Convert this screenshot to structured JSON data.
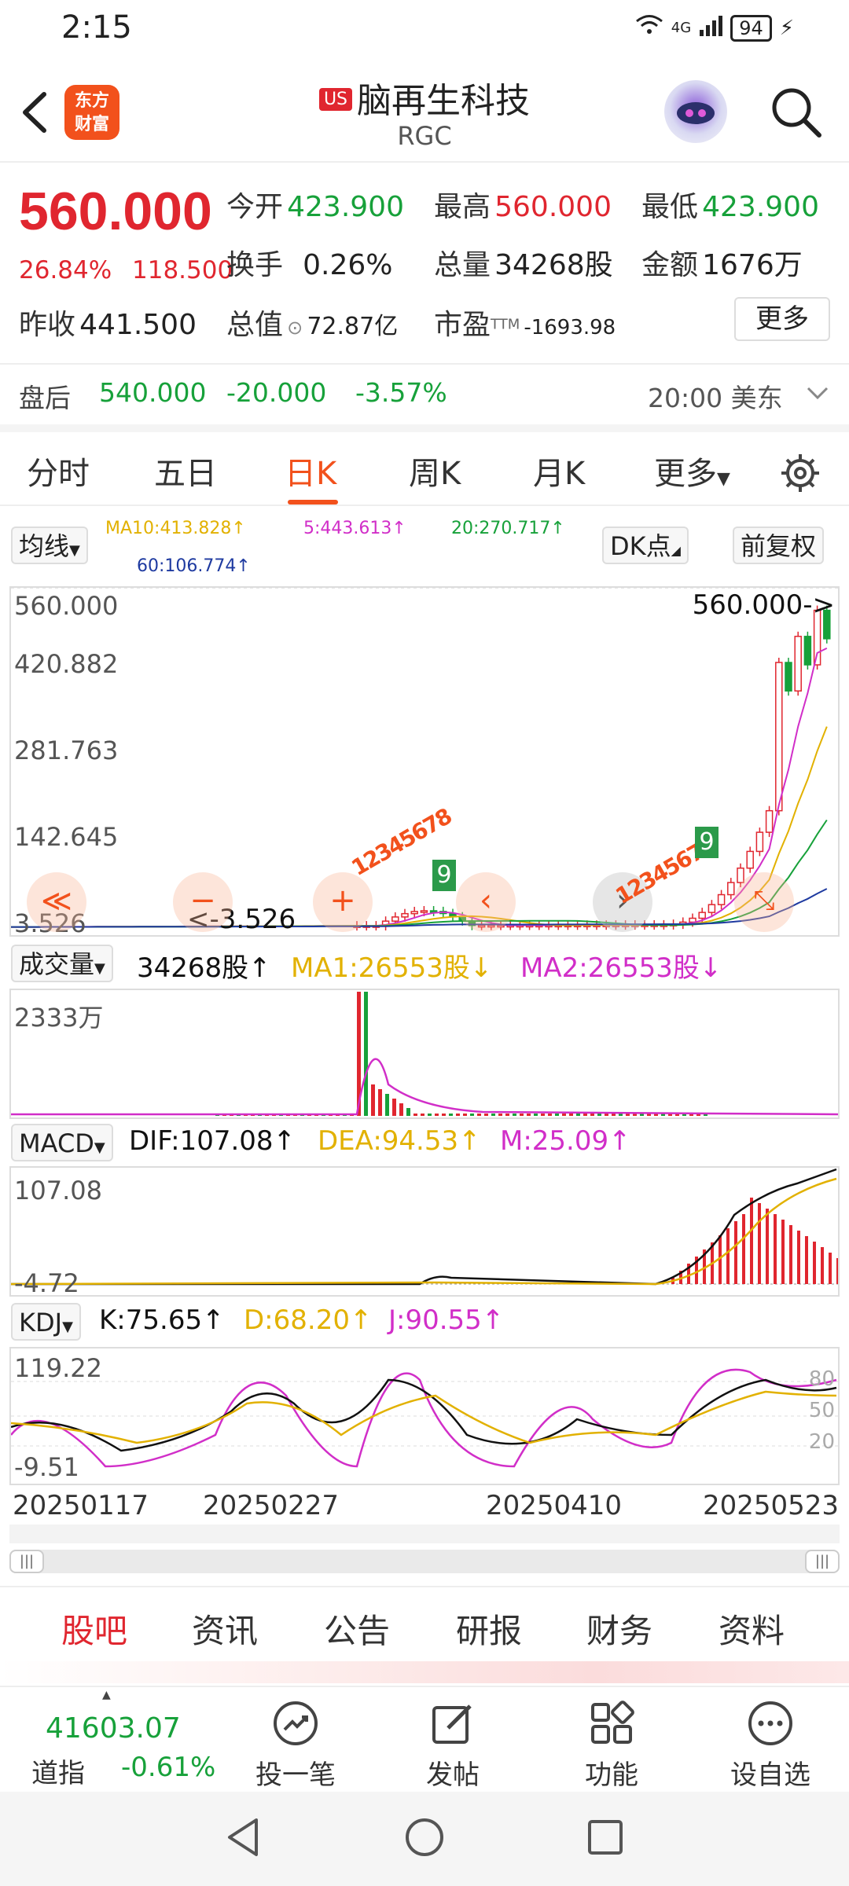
{
  "status": {
    "time": "2:15",
    "battery": "94",
    "net": "4G"
  },
  "header": {
    "logo_line1": "东方",
    "logo_line2": "财富",
    "badge": "US",
    "name": "脑再生科技",
    "code": "RGC"
  },
  "quote": {
    "price": "560.000",
    "change_pct": "26.84%",
    "change_abs": "118.500",
    "open_label": "今开",
    "open": "423.900",
    "high_label": "最高",
    "high": "560.000",
    "low_label": "最低",
    "low": "423.900",
    "turnover_label": "换手",
    "turnover": "0.26%",
    "volume_label": "总量",
    "volume": "34268股",
    "amount_label": "金额",
    "amount": "1676万",
    "prev_close_label": "昨收",
    "prev_close": "441.500",
    "mktcap_label": "总值",
    "mktcap": "72.87亿",
    "pe_label": "市盈",
    "pe_sup": "TTM",
    "pe": "-1693.98",
    "more": "更多"
  },
  "after_hours": {
    "label": "盘后",
    "price": "540.000",
    "change": "-20.000",
    "pct": "-3.57%",
    "time": "20:00 美东"
  },
  "tabs": [
    "分时",
    "五日",
    "日K",
    "周K",
    "月K",
    "更多"
  ],
  "active_tab": "日K",
  "kline": {
    "ma_selector": "均线",
    "ma10": "MA10:413.828↑",
    "ma5": "5:443.613↑",
    "ma20": "20:270.717↑",
    "ma60": "60:106.774↑",
    "dk_btn": "DK点",
    "adjust_btn": "前复权",
    "y_labels": [
      "560.000",
      "420.882",
      "281.763",
      "142.645",
      "3.526"
    ],
    "max_marker": "560.000->",
    "min_marker": "<-3.526",
    "nine_label": "9",
    "seq_a": "12345678",
    "seq_b": "12345678"
  },
  "volume": {
    "selector": "成交量",
    "value": "34268股↑",
    "ma1": "MA1:26553股↓",
    "ma2": "MA2:26553股↓",
    "y_label": "2333万"
  },
  "macd": {
    "selector": "MACD",
    "dif": "DIF:107.08↑",
    "dea": "DEA:94.53↑",
    "m": "M:25.09↑",
    "y_top": "107.08",
    "y_bottom": "-4.72"
  },
  "kdj": {
    "selector": "KDJ",
    "k": "K:75.65↑",
    "d": "D:68.20↑",
    "j": "J:90.55↑",
    "y_top": "119.22",
    "y_bottom": "-9.51",
    "levels": [
      "80",
      "50",
      "20"
    ]
  },
  "dates": [
    "20250117",
    "20250227",
    "20250410",
    "20250523"
  ],
  "info_tabs": [
    "股吧",
    "资讯",
    "公告",
    "研报",
    "财务",
    "资料"
  ],
  "bottom": {
    "index_value": "41603.07",
    "index_name": "道指",
    "index_pct": "-0.61%",
    "items": [
      "投一笔",
      "发帖",
      "功能",
      "设自选"
    ]
  },
  "colors": {
    "up": "#e0262f",
    "down": "#17a13a",
    "accent": "#f2511c",
    "ma5": "#d12ec8",
    "ma10": "#e2b100",
    "ma20": "#17a13a",
    "ma60": "#1e3aa0"
  }
}
